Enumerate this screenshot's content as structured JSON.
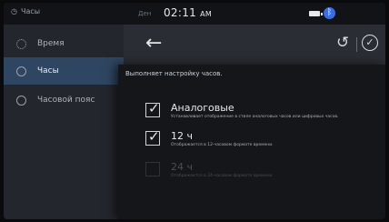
{
  "statusbar": {
    "app_label": "Часы",
    "small_text": "Ден",
    "time": "02:11",
    "ampm": "AM"
  },
  "sidebar": {
    "items": [
      {
        "label": "Время",
        "icon": "gear-icon",
        "active": false
      },
      {
        "label": "Часы",
        "icon": "clock-icon",
        "active": true
      },
      {
        "label": "Часовой пояс",
        "icon": "clock-icon",
        "active": false
      }
    ]
  },
  "header": {
    "back_icon": "back-arrow-icon",
    "reset_icon": "reset-icon",
    "confirm_icon": "check-circle-icon"
  },
  "popup": {
    "title": "Выполняет настройку часов.",
    "options": [
      {
        "label": "Аналоговые",
        "desc": "Устанавливает отображение в стиле аналоговых часов или цифровых часов.",
        "checked": true,
        "enabled": true
      },
      {
        "label": "12 ч",
        "desc": "Отображается в 12-часовом формате времени.",
        "checked": true,
        "enabled": true
      },
      {
        "label": "24 ч",
        "desc": "Отображается в 24-часовом формате времени.",
        "checked": false,
        "enabled": false
      }
    ]
  }
}
